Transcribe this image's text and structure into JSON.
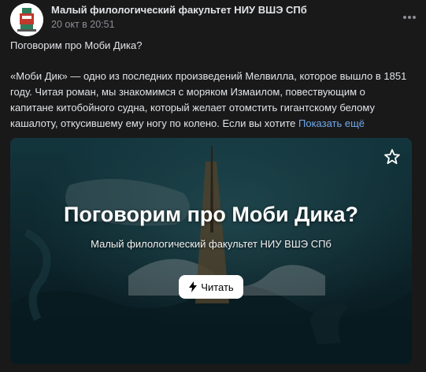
{
  "post": {
    "author": "Малый филологический факультет НИУ ВШЭ СПб",
    "date": "20 окт в 20:51",
    "title": "Поговорим про Моби Дика?",
    "body_lines": [
      "«Моби Дик» — одно из последних произведений Мелвилла, которое вышло в 1851",
      "году. Читая роман, мы знакомимся с моряком Измаилом, повествующим о",
      "капитане китобойного судна, который желает отомстить гигантскому белому",
      "кашалоту, откусившему ему ногу по колено. Если вы хотите"
    ],
    "show_more": "Показать ещё"
  },
  "card": {
    "title": "Поговорим про Моби Дика?",
    "subtitle": "Малый филологический факультет НИУ ВШЭ СПб",
    "read_label": "Читать"
  },
  "icons": {
    "more": "more-horizontal-icon",
    "favorite": "star-outline-icon",
    "read": "lightning-icon"
  },
  "colors": {
    "background": "#19191a",
    "link": "#71aaeb",
    "muted": "#8b8d92",
    "text": "#e1e3e6"
  }
}
